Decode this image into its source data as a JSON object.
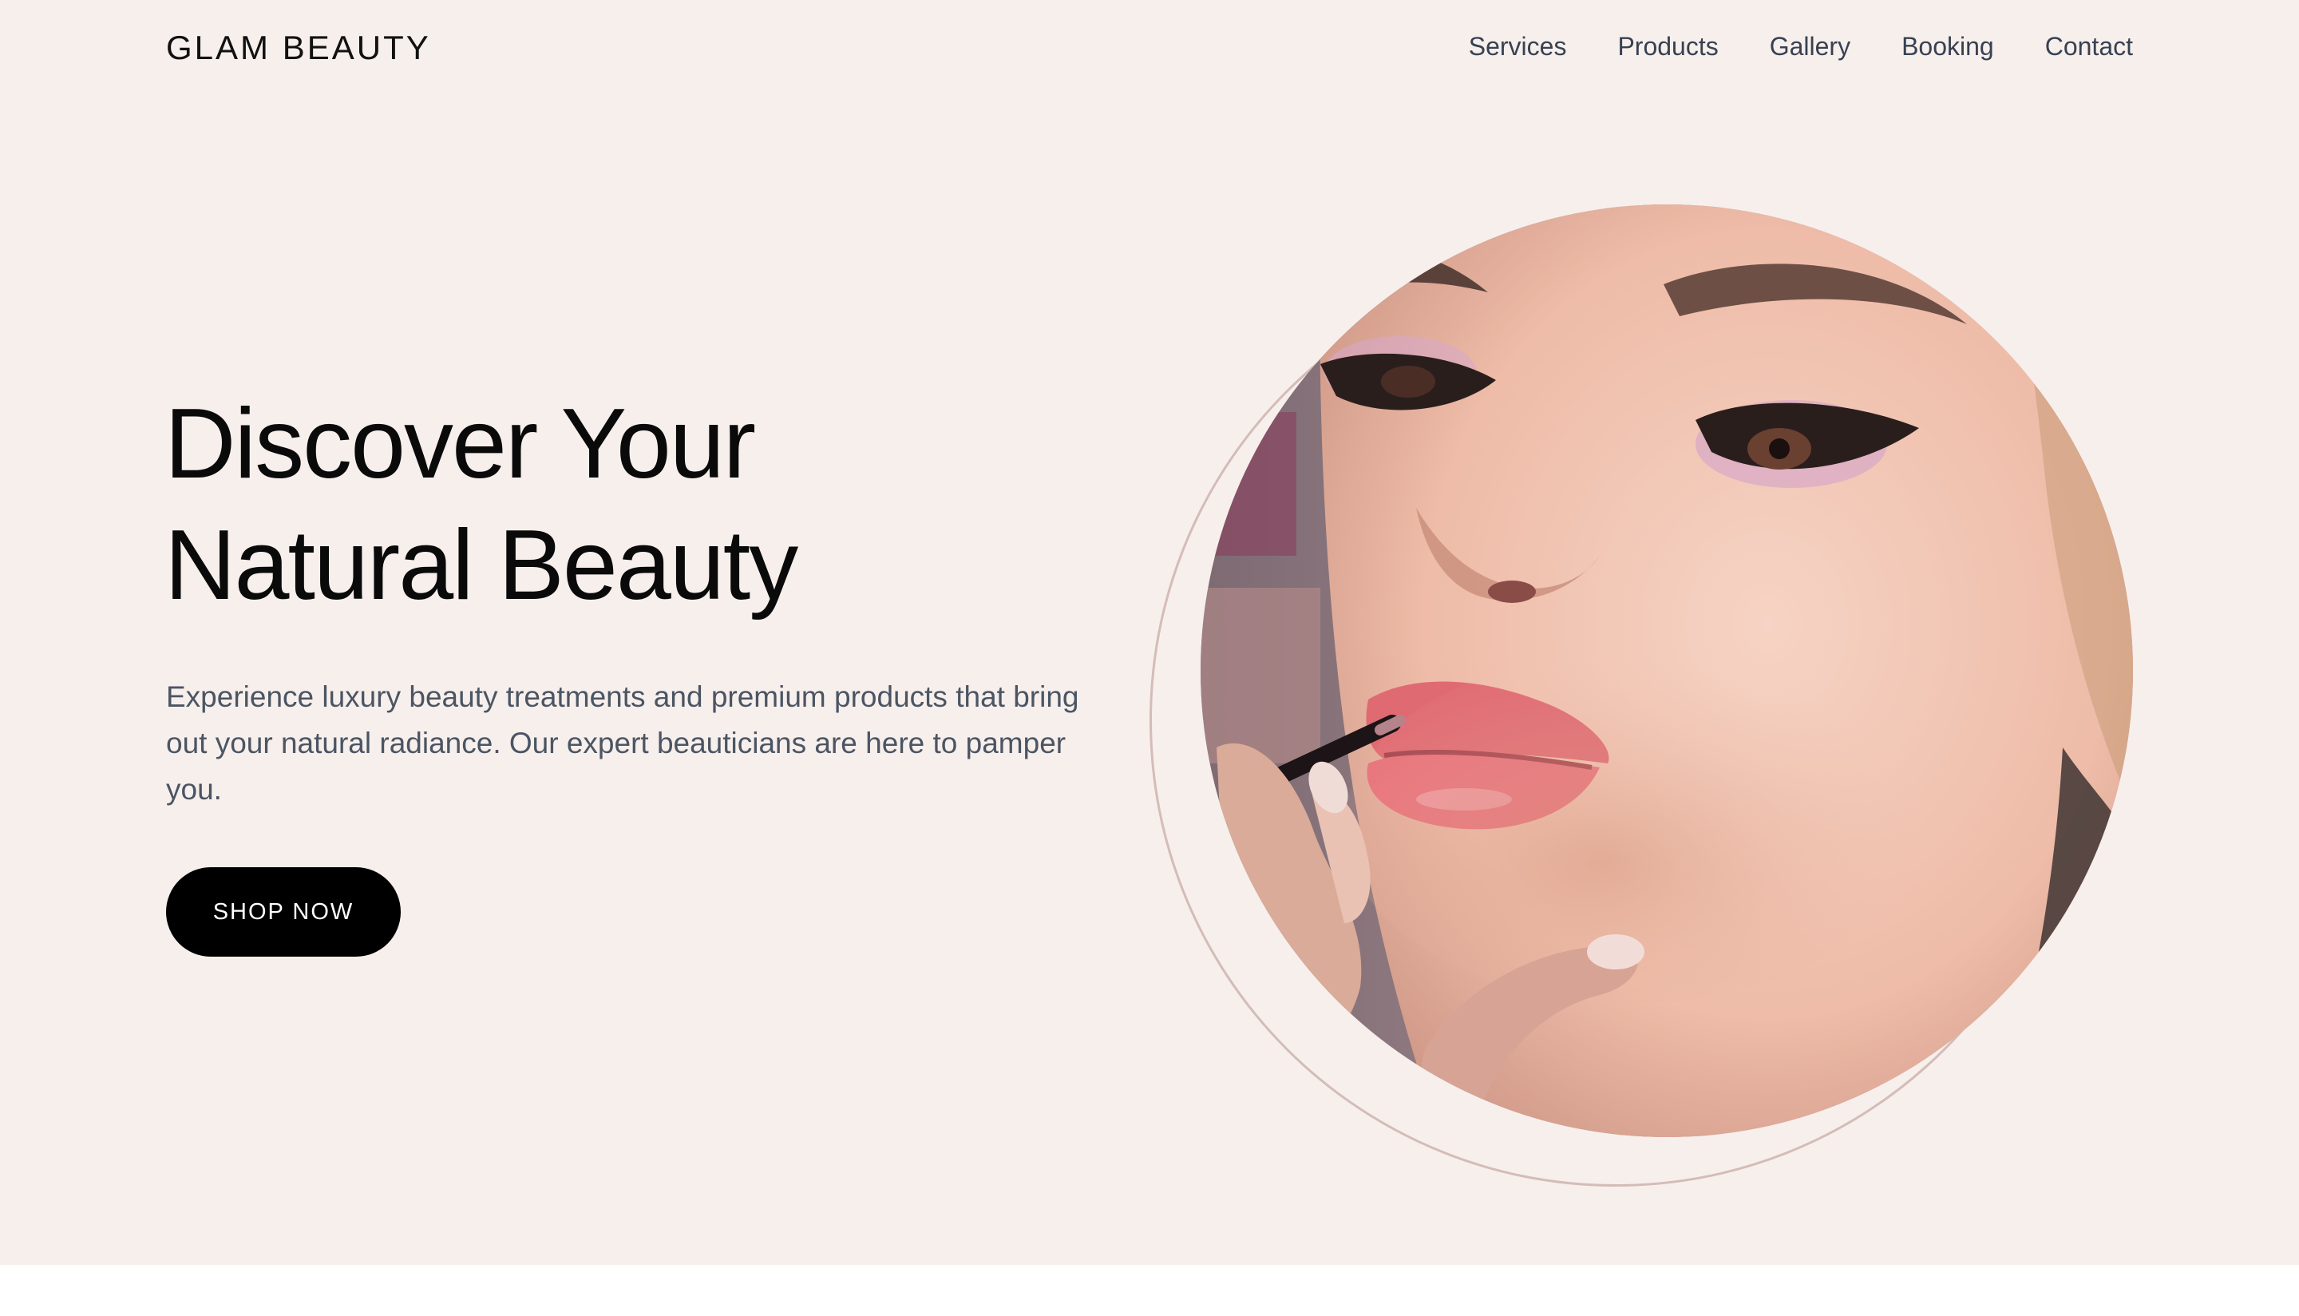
{
  "brand": {
    "logo": "GLAM BEAUTY"
  },
  "nav": {
    "items": [
      {
        "label": "Services"
      },
      {
        "label": "Products"
      },
      {
        "label": "Gallery"
      },
      {
        "label": "Booking"
      },
      {
        "label": "Contact"
      }
    ]
  },
  "hero": {
    "headline_line1": "Discover Your",
    "headline_line2": "Natural Beauty",
    "description": "Experience luxury beauty treatments and premium products that bring out your natural radiance. Our expert beauticians are here to pamper you.",
    "cta_label": "SHOP NOW",
    "image_icon": "portrait-photo"
  },
  "colors": {
    "hero_background": "#f7efec",
    "page_background": "#ffffff",
    "button_background": "#000000",
    "ring_stroke": "#d4bcb8",
    "nav_text": "#374151",
    "body_text": "#4b5563"
  }
}
